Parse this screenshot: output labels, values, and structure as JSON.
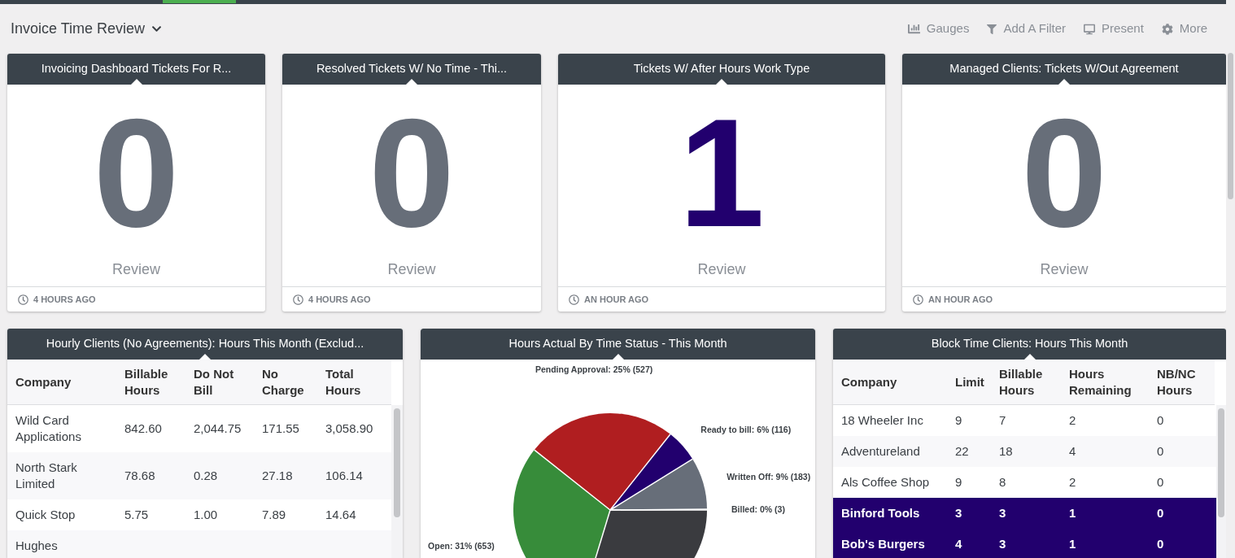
{
  "header": {
    "title": "Invoice Time Review",
    "actions": [
      {
        "kind": "gauges",
        "label": "Gauges"
      },
      {
        "kind": "filter",
        "label": "Add A Filter"
      },
      {
        "kind": "present",
        "label": "Present"
      },
      {
        "kind": "more",
        "label": "More"
      }
    ]
  },
  "gauges": [
    {
      "title": "Invoicing Dashboard Tickets For R...",
      "value": "0",
      "color": "#676e79",
      "caption": "Review",
      "updated": "4 HOURS AGO"
    },
    {
      "title": "Resolved Tickets W/ No Time - Thi...",
      "value": "0",
      "color": "#676e79",
      "caption": "Review",
      "updated": "4 HOURS AGO"
    },
    {
      "title": "Tickets W/ After Hours Work Type",
      "value": "1",
      "color": "#22006e",
      "caption": "Review",
      "updated": "AN HOUR AGO"
    },
    {
      "title": "Managed Clients: Tickets W/Out Agreement",
      "value": "0",
      "color": "#676e79",
      "caption": "Review",
      "updated": "AN HOUR AGO"
    }
  ],
  "hourly_table": {
    "title": "Hourly Clients (No Agreements): Hours This Month (Exclud...",
    "columns": [
      "Company",
      "Billable Hours",
      "Do Not Bill",
      "No Charge",
      "Total Hours"
    ],
    "rows": [
      {
        "cells": [
          "Wild Card Applications",
          "842.60",
          "2,044.75",
          "171.55",
          "3,058.90"
        ]
      },
      {
        "cells": [
          "North Stark Limited",
          "78.68",
          "0.28",
          "27.18",
          "106.14"
        ]
      },
      {
        "cells": [
          "Quick Stop",
          "5.75",
          "1.00",
          "7.89",
          "14.64"
        ]
      },
      {
        "cells": [
          "Hughes"
        ]
      }
    ]
  },
  "pie_panel": {
    "title": "Hours Actual By Time Status - This Month",
    "chart_data": {
      "type": "pie",
      "categories": [
        "Open",
        "Pending Approval",
        "Ready to bill",
        "Written Off",
        "Billed",
        null
      ],
      "values": [
        653,
        527,
        116,
        183,
        3,
        626
      ],
      "colors": [
        "#378c3a",
        "#b01e20",
        "#22006e",
        "#676e79",
        "#3a3b3f",
        "#3a3b3f"
      ],
      "value_labels": [
        ": 31% (653)",
        ": 25% (527)",
        ": 6% (116)",
        ": 9% (183)",
        ": 0% (3)",
        null
      ]
    }
  },
  "block_table": {
    "title": "Block Time Clients: Hours This Month",
    "columns": [
      "Company",
      "Limit",
      "Billable Hours",
      "Hours Remaining",
      "NB/NC Hours"
    ],
    "rows": [
      {
        "highlighted": false,
        "cells": [
          "18 Wheeler Inc",
          "9",
          "7",
          "2",
          "0"
        ]
      },
      {
        "highlighted": false,
        "cells": [
          "Adventureland",
          "22",
          "18",
          "4",
          "0"
        ]
      },
      {
        "highlighted": false,
        "cells": [
          "Als Coffee Shop",
          "9",
          "8",
          "2",
          "0"
        ]
      },
      {
        "highlighted": true,
        "cells": [
          "Binford Tools",
          "3",
          "3",
          "1",
          "0"
        ]
      },
      {
        "highlighted": true,
        "cells": [
          "Bob's Burgers",
          "4",
          "3",
          "1",
          "0"
        ]
      }
    ]
  }
}
